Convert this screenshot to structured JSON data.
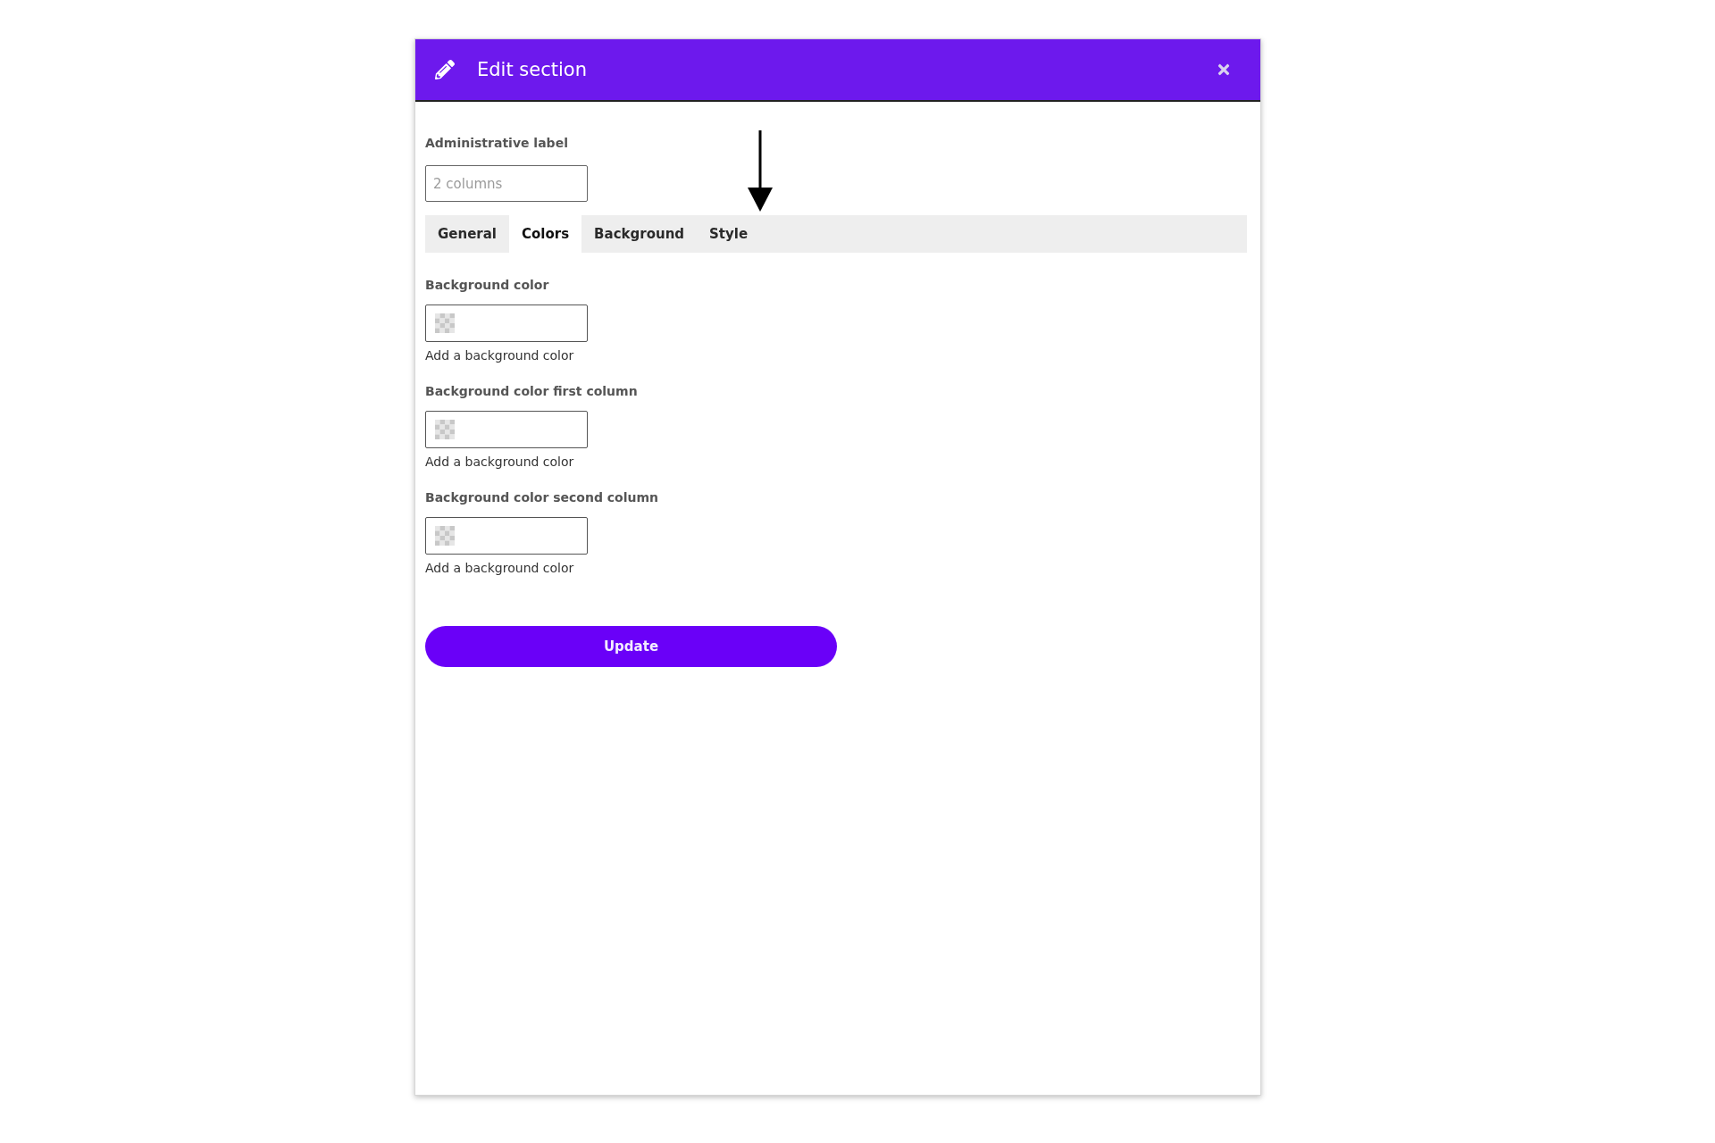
{
  "dialog": {
    "title": "Edit section"
  },
  "admin_label": {
    "label": "Administrative label",
    "placeholder": "2 columns"
  },
  "tabs": [
    {
      "label": "General",
      "selected": false
    },
    {
      "label": "Colors",
      "selected": true
    },
    {
      "label": "Background",
      "selected": false
    },
    {
      "label": "Style",
      "selected": false
    }
  ],
  "color_fields": [
    {
      "label": "Background color",
      "help": "Add a background color"
    },
    {
      "label": "Background color first column",
      "help": "Add a background color"
    },
    {
      "label": "Background color second column",
      "help": "Add a background color"
    }
  ],
  "buttons": [
    "Update"
  ]
}
